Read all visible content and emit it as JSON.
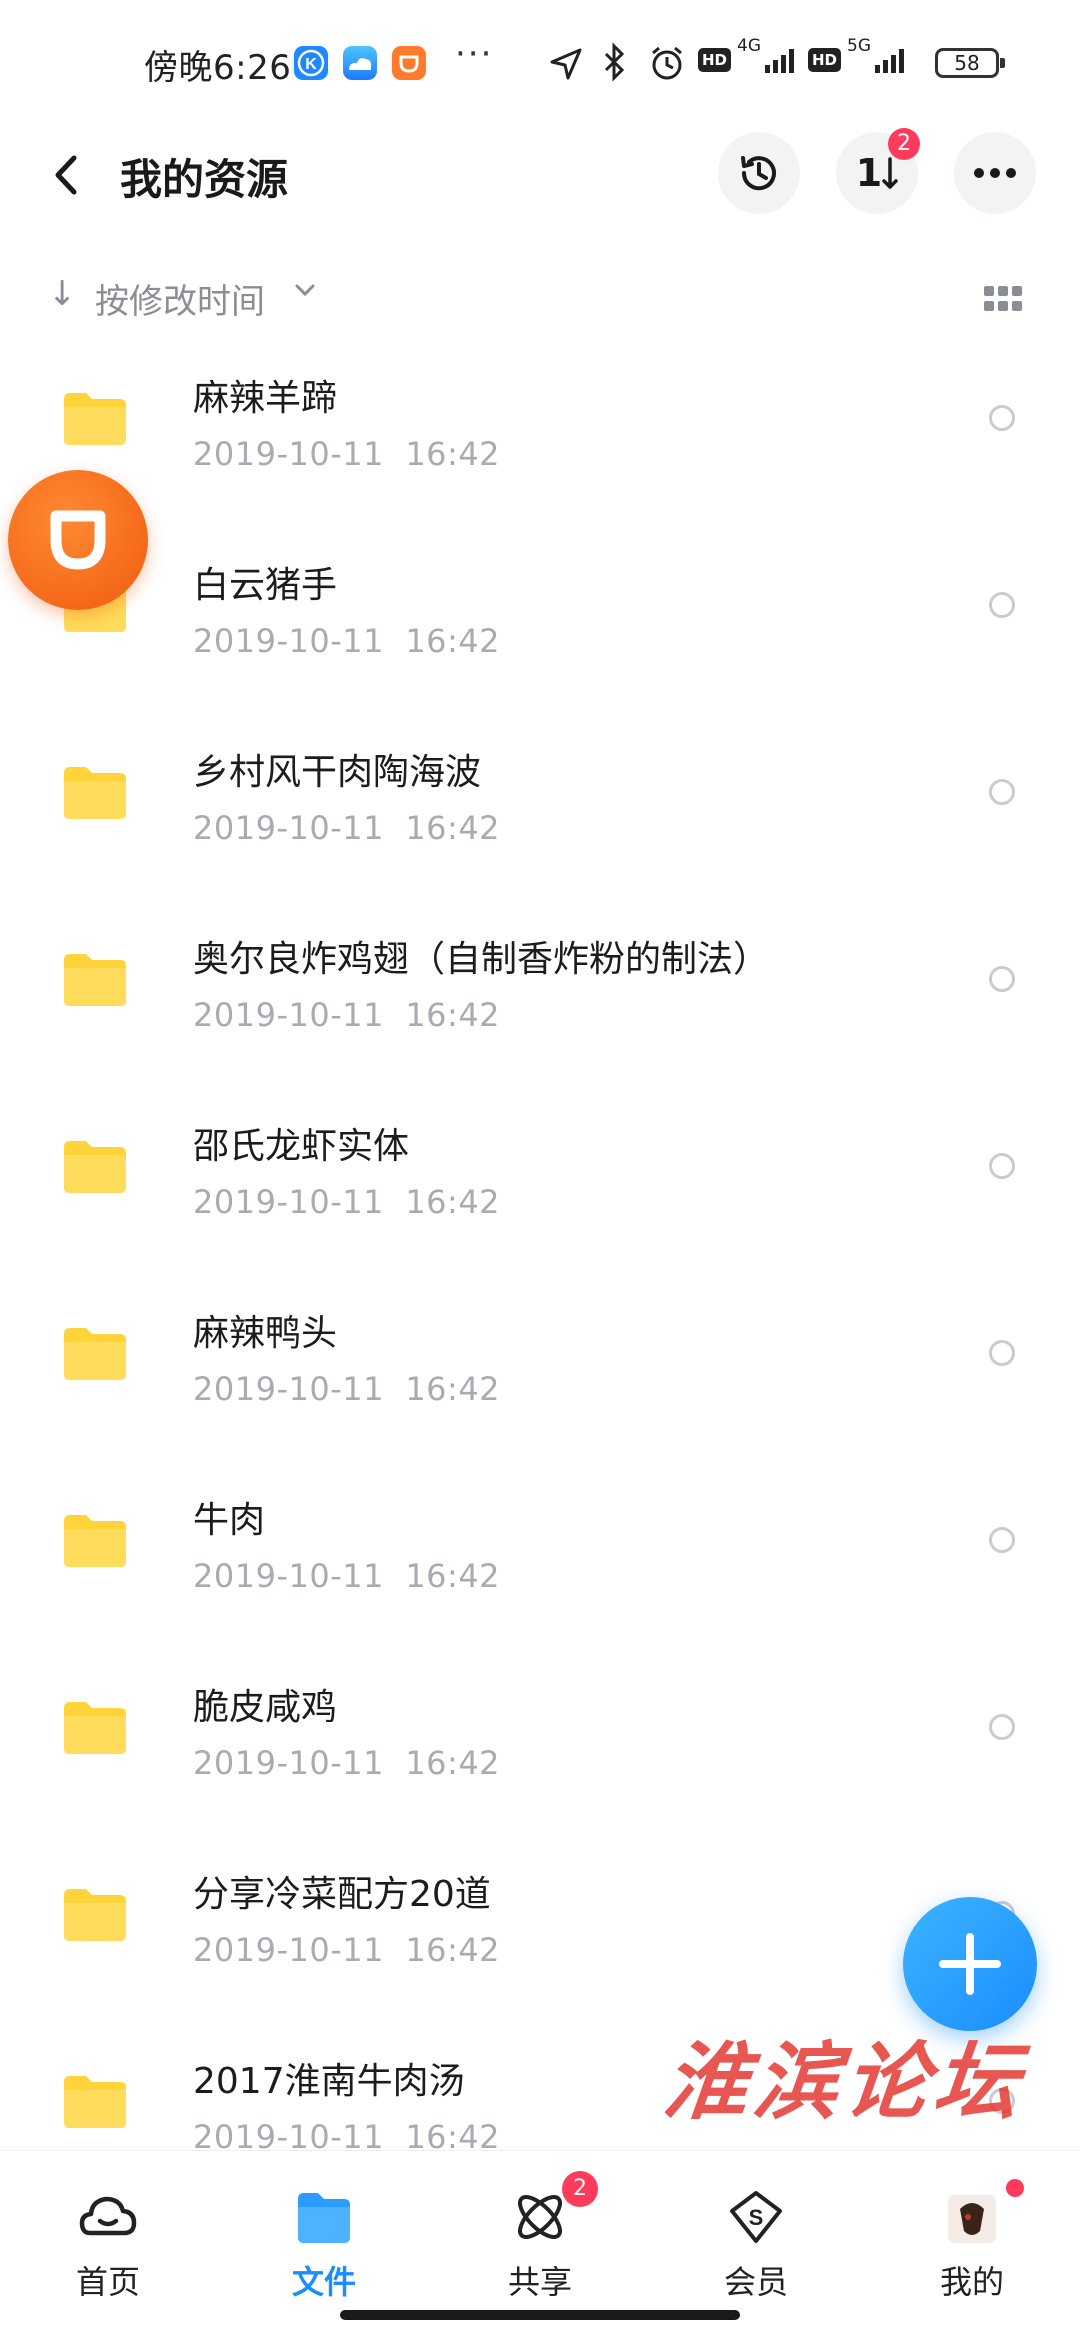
{
  "status_bar": {
    "time": "傍晚6:26",
    "dots": "···",
    "net1": "4G",
    "net2": "5G",
    "hd": "HD",
    "battery": "58"
  },
  "header": {
    "title": "我的资源",
    "transfer_label": "1",
    "transfer_badge": "2"
  },
  "sort": {
    "label": "按修改时间"
  },
  "files": [
    {
      "name": "麻辣羊蹄",
      "date": "2019-10-11  16:42"
    },
    {
      "name": "白云猪手",
      "date": "2019-10-11  16:42"
    },
    {
      "name": "乡村风干肉陶海波",
      "date": "2019-10-11  16:42"
    },
    {
      "name": "奥尔良炸鸡翅（自制香炸粉的制法）",
      "date": "2019-10-11  16:42"
    },
    {
      "name": "邵氏龙虾实体",
      "date": "2019-10-11  16:42"
    },
    {
      "name": "麻辣鸭头",
      "date": "2019-10-11  16:42"
    },
    {
      "name": "牛肉",
      "date": "2019-10-11  16:42"
    },
    {
      "name": "脆皮咸鸡",
      "date": "2019-10-11  16:42"
    },
    {
      "name": "分享冷菜配方20道",
      "date": "2019-10-11  16:42"
    },
    {
      "name": "2017淮南牛肉汤",
      "date": "2019-10-11  16:42"
    }
  ],
  "watermark": "淮滨论坛",
  "nav": {
    "home": "首页",
    "files": "文件",
    "share": "共享",
    "share_badge": "2",
    "vip": "会员",
    "mine": "我的"
  },
  "colors": {
    "accent": "#1a8dff",
    "folder": "#ffd43b",
    "badge": "#ff3b5c",
    "date": "#a8abb2"
  }
}
